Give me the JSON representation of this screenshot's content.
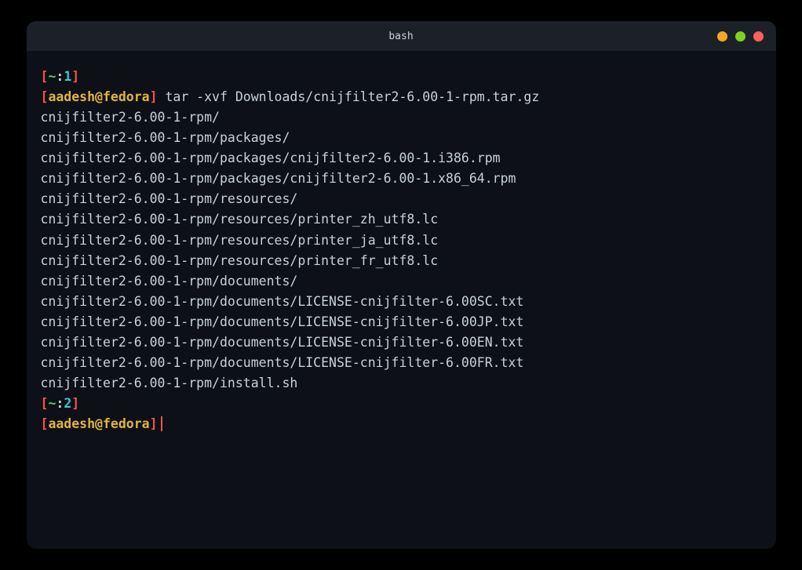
{
  "window": {
    "title": "bash"
  },
  "prompt1": {
    "open_bracket": "[",
    "path": "~",
    "colon": ":",
    "number": "1",
    "close_bracket": "]"
  },
  "prompt1_user": {
    "open_bracket": "[",
    "user_host": "aadesh@fedora",
    "close_bracket": "]",
    "command": " tar -xvf Downloads/cnijfilter2-6.00-1-rpm.tar.gz"
  },
  "output": {
    "line1": "cnijfilter2-6.00-1-rpm/",
    "line2": "cnijfilter2-6.00-1-rpm/packages/",
    "line3": "cnijfilter2-6.00-1-rpm/packages/cnijfilter2-6.00-1.i386.rpm",
    "line4": "cnijfilter2-6.00-1-rpm/packages/cnijfilter2-6.00-1.x86_64.rpm",
    "line5": "cnijfilter2-6.00-1-rpm/resources/",
    "line6": "cnijfilter2-6.00-1-rpm/resources/printer_zh_utf8.lc",
    "line7": "cnijfilter2-6.00-1-rpm/resources/printer_ja_utf8.lc",
    "line8": "cnijfilter2-6.00-1-rpm/resources/printer_fr_utf8.lc",
    "line9": "cnijfilter2-6.00-1-rpm/documents/",
    "line10": "cnijfilter2-6.00-1-rpm/documents/LICENSE-cnijfilter-6.00SC.txt",
    "line11": "cnijfilter2-6.00-1-rpm/documents/LICENSE-cnijfilter-6.00JP.txt",
    "line12": "cnijfilter2-6.00-1-rpm/documents/LICENSE-cnijfilter-6.00EN.txt",
    "line13": "cnijfilter2-6.00-1-rpm/documents/LICENSE-cnijfilter-6.00FR.txt",
    "line14": "cnijfilter2-6.00-1-rpm/install.sh"
  },
  "prompt2": {
    "open_bracket": "[",
    "path": "~",
    "colon": ":",
    "number": "2",
    "close_bracket": "]"
  },
  "prompt2_user": {
    "open_bracket": "[",
    "user_host": "aadesh@fedora",
    "close_bracket": "]"
  }
}
